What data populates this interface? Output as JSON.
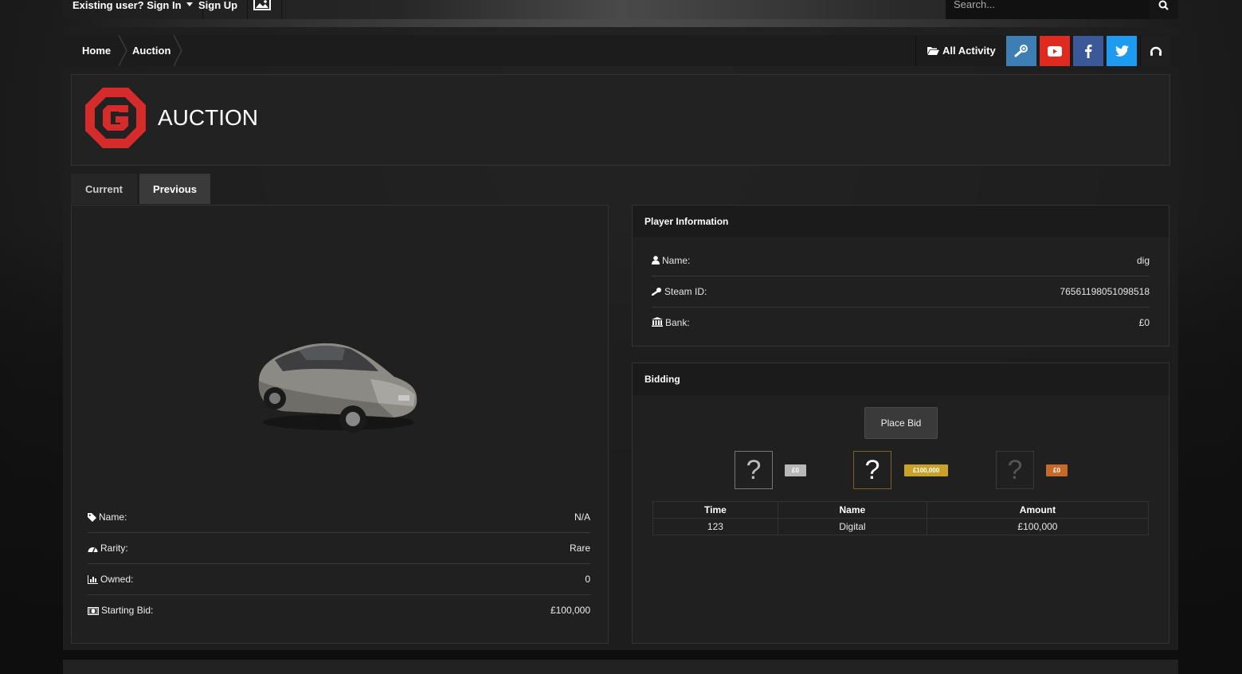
{
  "nav": {
    "signin_label": "Existing user? Sign In",
    "signup_label": "Sign Up",
    "search_placeholder": "Search..."
  },
  "breadcrumb": {
    "home": "Home",
    "current": "Auction"
  },
  "header_actions": {
    "all_activity": "All Activity",
    "socials": [
      "steam-icon",
      "youtube-icon",
      "facebook-icon",
      "twitter-icon",
      "teamspeak-icon"
    ]
  },
  "page": {
    "title": "AUCTION"
  },
  "tabs": [
    {
      "label": "Current"
    },
    {
      "label": "Previous"
    }
  ],
  "item": {
    "rows": [
      {
        "label": "Name:",
        "value": "N/A"
      },
      {
        "label": "Rarity:",
        "value": "Rare"
      },
      {
        "label": "Owned:",
        "value": "0"
      },
      {
        "label": "Starting Bid:",
        "value": "£100,000"
      }
    ]
  },
  "player": {
    "heading": "Player Information",
    "rows": [
      {
        "label": "Name:",
        "value": "dig"
      },
      {
        "label": "Steam ID:",
        "value": "76561198051098518"
      },
      {
        "label": "Bank:",
        "value": "£0"
      }
    ]
  },
  "bidding": {
    "heading": "Bidding",
    "place_bid": "Place Bid",
    "top_bidders": [
      {
        "symbol": "?",
        "amount": "£0",
        "color": "#b8b8b8"
      },
      {
        "symbol": "?",
        "amount": "£100,000",
        "color": "#c9a227"
      },
      {
        "symbol": "?",
        "amount": "£0",
        "color": "#c8692a"
      }
    ],
    "table": {
      "headers": [
        "Time",
        "Name",
        "Amount"
      ],
      "rows": [
        [
          "123",
          "Digital",
          "£100,000"
        ]
      ]
    }
  },
  "colors": {
    "youtube": "#e02a20",
    "steam": "#3d7fb5",
    "facebook": "#3b5998",
    "twitter": "#1d9bf0",
    "logo_red": "#d62b2b"
  }
}
